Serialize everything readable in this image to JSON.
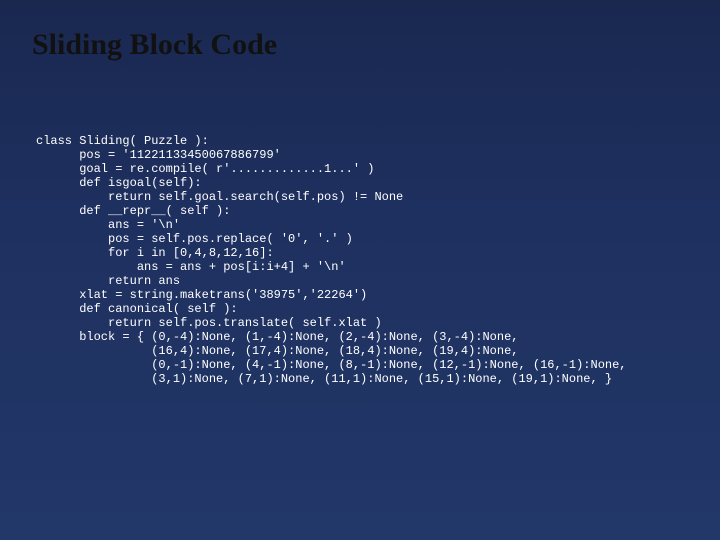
{
  "slide": {
    "title": "Sliding Block Code",
    "code": "class Sliding( Puzzle ):\n      pos = '11221133450067886799'\n      goal = re.compile( r'.............1...' )\n      def isgoal(self):\n          return self.goal.search(self.pos) != None\n      def __repr__( self ):\n          ans = '\\n'\n          pos = self.pos.replace( '0', '.' )\n          for i in [0,4,8,12,16]:\n              ans = ans + pos[i:i+4] + '\\n'\n          return ans\n      xlat = string.maketrans('38975','22264')\n      def canonical( self ):\n          return self.pos.translate( self.xlat )\n      block = { (0,-4):None, (1,-4):None, (2,-4):None, (3,-4):None,\n                (16,4):None, (17,4):None, (18,4):None, (19,4):None,\n                (0,-1):None, (4,-1):None, (8,-1):None, (12,-1):None, (16,-1):None,\n                (3,1):None, (7,1):None, (11,1):None, (15,1):None, (19,1):None, }"
  }
}
